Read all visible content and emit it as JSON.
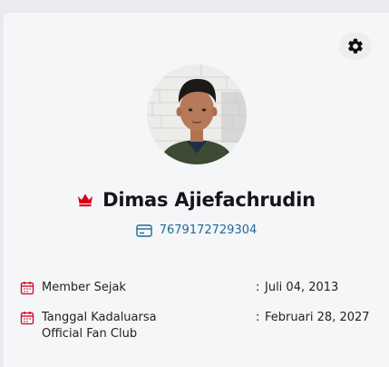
{
  "profile": {
    "name": "Dimas Ajiefachrudin",
    "member_id": "7679172729304"
  },
  "details": [
    {
      "label": "Member Sejak",
      "separator": ":",
      "value": "Juli 04, 2013"
    },
    {
      "label_line1": "Tanggal Kadaluarsa",
      "label_line2": "Official Fan Club",
      "separator": ":",
      "value": "Februari 28, 2027"
    }
  ],
  "icons": {
    "settings": "gear-icon",
    "rank": "crown-icon",
    "card": "id-card-icon",
    "date": "calendar-icon"
  },
  "colors": {
    "accent_red": "#d8001c",
    "link_blue": "#1f6a96",
    "name": "#15151f"
  }
}
